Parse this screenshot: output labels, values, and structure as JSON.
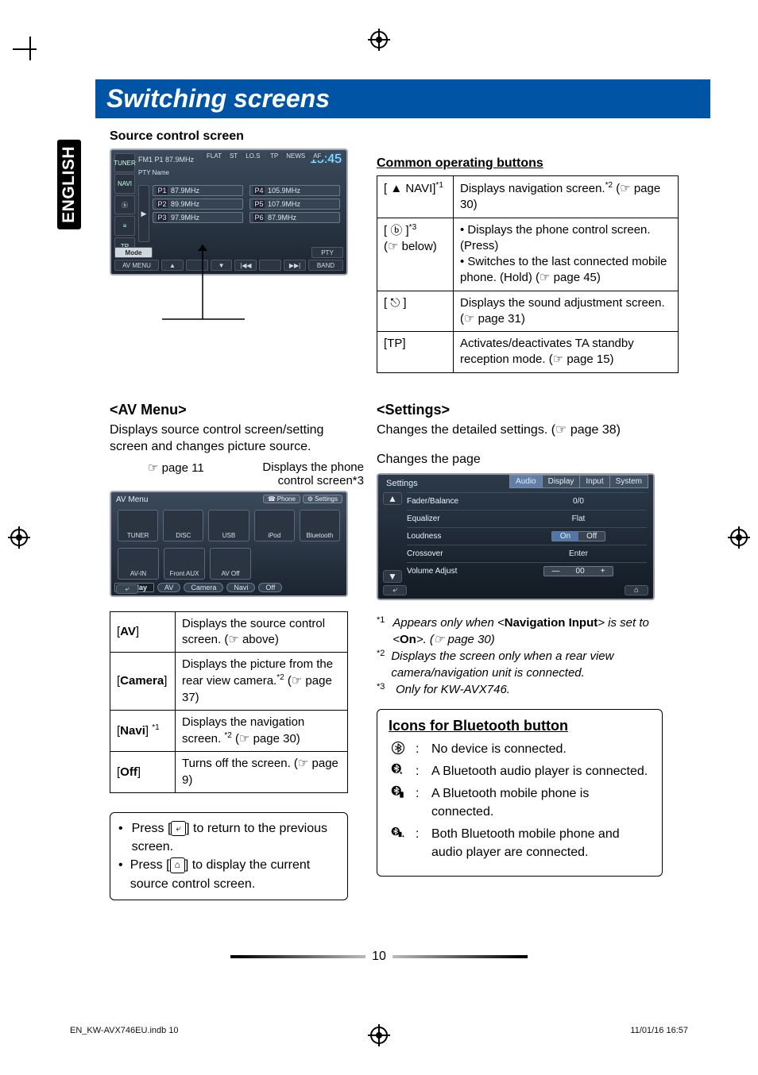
{
  "lang_tab": "ENGLISH",
  "page_title": "Switching screens",
  "source_control_heading": "Source control screen",
  "tuner_screenshot": {
    "sidebar": [
      "TUNER",
      "NAVI",
      "",
      "",
      "TP"
    ],
    "header_chips": [
      "FLAT",
      "ST",
      "LO.S",
      "TP",
      "NEWS",
      "AF"
    ],
    "fm_line": "FM1 P1 87.9MHz",
    "time": "15:45",
    "pty_label": "PTY Name",
    "presets": [
      {
        "n": "P1",
        "f": "87.9MHz"
      },
      {
        "n": "P4",
        "f": "105.9MHz"
      },
      {
        "n": "P2",
        "f": "89.9MHz"
      },
      {
        "n": "P5",
        "f": "107.9MHz"
      },
      {
        "n": "P3",
        "f": "97.9MHz"
      },
      {
        "n": "P6",
        "f": "87.9MHz"
      }
    ],
    "bottom_row1": [
      "Mode",
      "",
      "PTY"
    ],
    "bottom_row2": [
      "AV MENU",
      "▲",
      "",
      "▼",
      "|◀◀",
      "",
      "▶▶|",
      "BAND"
    ]
  },
  "common_heading": "Common operating buttons",
  "common_table": [
    {
      "key": "[ ▲ NAVI]*1",
      "val": "Displays navigation screen.*2 (☞ page 30)"
    },
    {
      "key": "[ ⓑ ]*3\n(☞ below)",
      "val": "• Displays the phone control screen. (Press)\n• Switches to the last connected mobile phone. (Hold) (☞ page 45)"
    },
    {
      "key": "[ ⎋ ]",
      "val": "Displays the sound adjustment screen. (☞ page 31)"
    },
    {
      "key": "[TP]",
      "val": "Activates/deactivates TA standby reception mode. (☞ page 15)"
    }
  ],
  "avmenu": {
    "heading": "<AV Menu>",
    "body": "Displays source control screen/setting screen and changes picture source.",
    "note_left": "☞ page 11",
    "note_right": "Displays the phone control screen*3",
    "shot": {
      "title": "AV Menu",
      "hdr_buttons": [
        "Phone",
        "Settings"
      ],
      "sources_row1": [
        "TUNER",
        "DISC",
        "USB",
        "iPod",
        "Bluetooth"
      ],
      "sources_row2": [
        "AV-IN",
        "Front AUX",
        "AV Off"
      ],
      "display_bar": [
        "Display",
        "AV",
        "Camera",
        "Navi",
        "Off"
      ]
    },
    "table": [
      {
        "k": "[AV]",
        "v": "Displays the source control screen. (☞ above)"
      },
      {
        "k": "[Camera]",
        "v": "Displays the picture from the rear view camera.*2 (☞ page 37)"
      },
      {
        "k": "[Navi] *1",
        "v": "Displays the navigation screen. *2 (☞ page 30)"
      },
      {
        "k": "[Off]",
        "v": "Turns off the screen. (☞ page 9)"
      }
    ]
  },
  "tips": {
    "t1": "Press [ ⤶ ] to return to the previous screen.",
    "t2": "Press [ ⌂ ] to display the current source control screen."
  },
  "settings": {
    "heading": "<Settings>",
    "body": "Changes the detailed settings. (☞ page 38)",
    "changes_page": "Changes the page",
    "shot": {
      "title": "Settings",
      "tabs": [
        "Audio",
        "Display",
        "Input",
        "System"
      ],
      "rows": [
        {
          "label": "Fader/Balance",
          "val": "0/0",
          "type": "center"
        },
        {
          "label": "Equalizer",
          "val": "Flat",
          "type": "center"
        },
        {
          "label": "Loudness",
          "on": "On",
          "off": "Off",
          "type": "seg"
        },
        {
          "label": "Crossover",
          "val": "Enter",
          "type": "center"
        },
        {
          "label": "Volume Adjust",
          "minus": "—",
          "num": "00",
          "plus": "+",
          "type": "stepper"
        }
      ]
    }
  },
  "footnotes": [
    {
      "n": "*1",
      "t": "Appears only when <Navigation Input> is set to <On>. (☞ page 30)",
      "bold": [
        "Navigation Input",
        "On"
      ]
    },
    {
      "n": "*2",
      "t": "Displays the screen only when a rear view camera/navigation unit is connected."
    },
    {
      "n": "*3",
      "t": "Only for KW-AVX746."
    }
  ],
  "bt_box": {
    "heading": "Icons for Bluetooth button",
    "rows": [
      {
        "t": "No device is connected."
      },
      {
        "t": "A Bluetooth audio player is connected."
      },
      {
        "t": "A Bluetooth mobile phone is connected."
      },
      {
        "t": "Both Bluetooth mobile phone and audio player are connected."
      }
    ]
  },
  "page_number": "10",
  "footer_left": "EN_KW-AVX746EU.indb   10",
  "footer_right": "11/01/16   16:57"
}
